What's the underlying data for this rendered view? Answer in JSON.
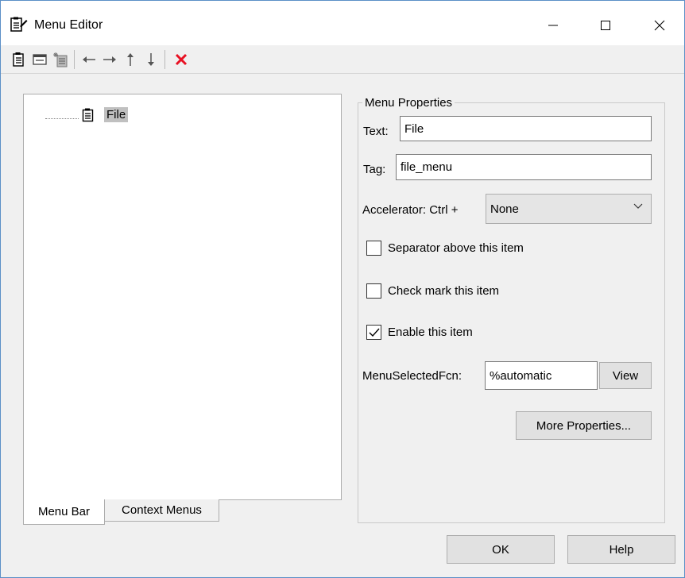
{
  "window": {
    "title": "Menu Editor"
  },
  "tree": {
    "root_label": "File"
  },
  "tabs": [
    {
      "label": "Menu Bar",
      "active": true
    },
    {
      "label": "Context Menus",
      "active": false
    }
  ],
  "properties": {
    "group_title": "Menu Properties",
    "text_label": "Text:",
    "text_value": "File",
    "tag_label": "Tag:",
    "tag_value": "file_menu",
    "accelerator_label": "Accelerator: Ctrl +",
    "accelerator_value": "None",
    "checkboxes": [
      {
        "label": "Separator above this item",
        "checked": false
      },
      {
        "label": "Check mark this item",
        "checked": false
      },
      {
        "label": "Enable this item",
        "checked": true
      }
    ],
    "callback_label": "MenuSelectedFcn:",
    "callback_value": "%automatic",
    "view_label": "View",
    "more_label": "More Properties..."
  },
  "footer": {
    "ok_label": "OK",
    "help_label": "Help"
  },
  "colors": {
    "delete_red": "#e81123",
    "selection_gray": "#c0c0c0"
  }
}
